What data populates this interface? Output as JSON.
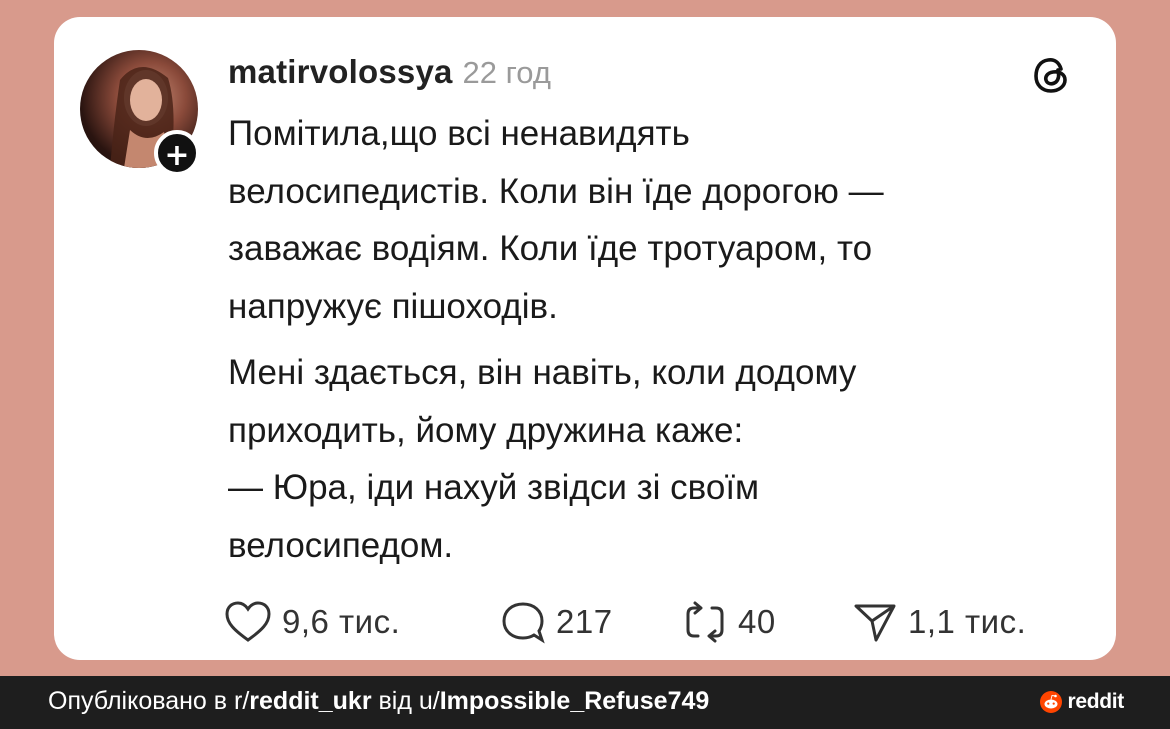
{
  "post": {
    "username": "matirvolossya",
    "time": "22 год",
    "paragraph1": [
      "Помітила,що всі ненавидять",
      "велосипедистів. Коли він їде дорогою —",
      "заважає водіям. Коли їде тротуаром, то",
      "напружує пішоходів."
    ],
    "paragraph2": [
      "Мені здається, він навіть, коли додому",
      "приходить, йому дружина каже:",
      "— Юра, іди нахуй звідси зі своїм",
      "велосипедом."
    ]
  },
  "actions": {
    "likes": "9,6 тис.",
    "replies": "217",
    "reposts": "40",
    "shares": "1,1 тис."
  },
  "footer": {
    "prefix": "Опубліковано в r/",
    "subreddit": "reddit_ukr",
    "middle": " від u/",
    "user": "Impossible_Refuse749",
    "brand": "reddit"
  },
  "colors": {
    "background": "#d89a8c",
    "card": "#ffffff",
    "footer": "#1e1e1e",
    "reddit_orange": "#ff4500"
  },
  "icons": [
    "plus-icon",
    "threads-logo-icon",
    "heart-icon",
    "comment-icon",
    "repost-icon",
    "share-icon",
    "reddit-logo-icon"
  ]
}
